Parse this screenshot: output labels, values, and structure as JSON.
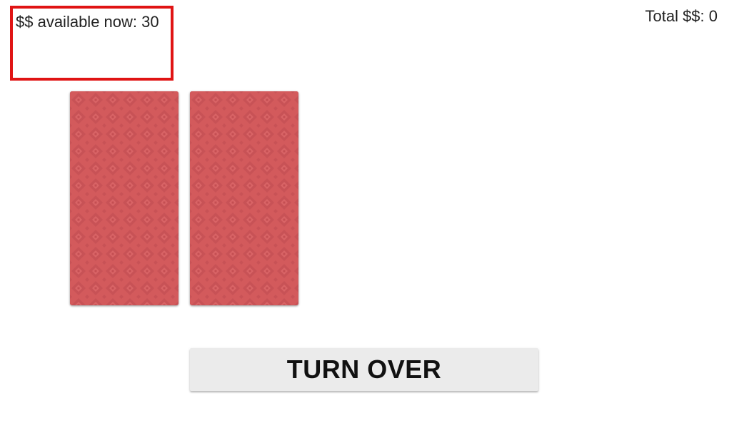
{
  "status": {
    "available_label": "$$ available now: 30",
    "total_label": "Total $$: 0",
    "highlight_color": "#e01414"
  },
  "cards": [
    {
      "state": "face-down",
      "back_color": "#d35a5c"
    },
    {
      "state": "face-down",
      "back_color": "#d35a5c"
    }
  ],
  "actions": {
    "turn_over_label": "TURN OVER"
  }
}
